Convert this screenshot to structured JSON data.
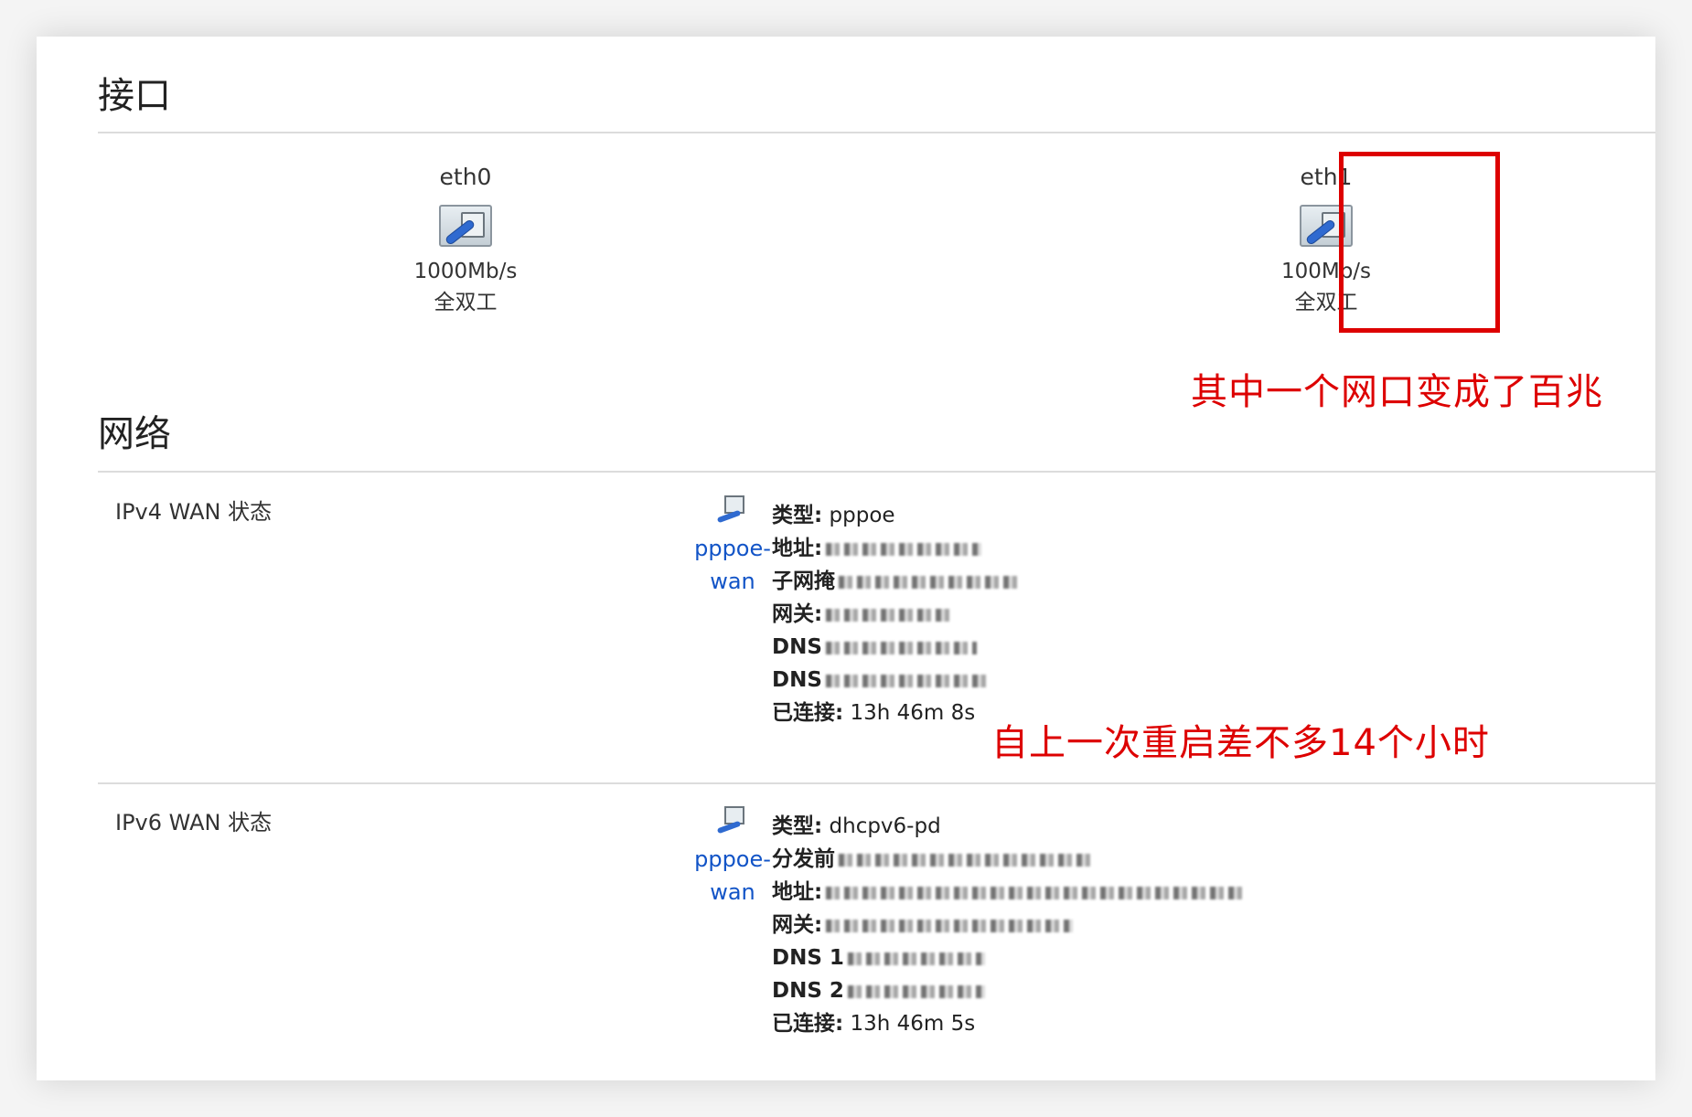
{
  "sections": {
    "interfaces_title": "接口",
    "network_title": "网络"
  },
  "interfaces": [
    {
      "name": "eth0",
      "speed": "1000Mb/s",
      "duplex": "全双工"
    },
    {
      "name": "eth1",
      "speed": "100Mb/s",
      "duplex": "全双工"
    }
  ],
  "annotations": {
    "port_note": "其中一个网口变成了百兆",
    "uptime_note": "自上一次重启差不多14个小时",
    "color": "#dd0000"
  },
  "ipv4": {
    "label": "IPv4 WAN 状态",
    "iface_link_1": "pppoe-",
    "iface_link_2": "wan",
    "type_key": "类型:",
    "type_val": " pppoe",
    "addr_key": "地址:",
    "mask_key": "子网掩",
    "gw_key": "网关:",
    "dns1_key": "DNS",
    "dns2_key": "DNS",
    "connected_key": "已连接:",
    "connected_val": " 13h 46m 8s"
  },
  "ipv6": {
    "label": "IPv6 WAN 状态",
    "iface_link_1": "pppoe-",
    "iface_link_2": "wan",
    "type_key": "类型:",
    "type_val": " dhcpv6-pd",
    "prefix_key": "分发前",
    "addr_key": "地址:",
    "gw_key": "网关:",
    "dns1_key": "DNS 1",
    "dns2_key": "DNS 2",
    "connected_key": "已连接:",
    "connected_val": " 13h 46m 5s"
  },
  "icons": {
    "port": "ethernet-port-icon",
    "network": "network-interface-icon"
  },
  "colors": {
    "link": "#1254c7",
    "highlight": "#dd0000"
  }
}
